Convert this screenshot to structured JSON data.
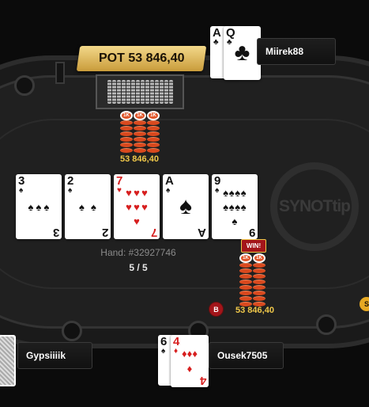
{
  "pot": {
    "label": "POT 53 846,40"
  },
  "pot_chips_amount": "53 846,40",
  "winner_chips_amount": "53 846,40",
  "chip_denomination": "1K",
  "hand": {
    "number": "Hand: #32927746",
    "progress": "5 / 5"
  },
  "win_badge": "WIN!",
  "dealer_button": "B",
  "edge_chip": "S",
  "logo": "SYNOTtip",
  "board": [
    {
      "rank": "3",
      "suit": "♠",
      "color": "black"
    },
    {
      "rank": "2",
      "suit": "♠",
      "color": "black"
    },
    {
      "rank": "7",
      "suit": "♥",
      "color": "red"
    },
    {
      "rank": "A",
      "suit": "♠",
      "color": "black"
    },
    {
      "rank": "9",
      "suit": "♠",
      "color": "black"
    }
  ],
  "players": {
    "top": {
      "name": "Miirek88",
      "cards": [
        {
          "rank": "A",
          "suit": "♣",
          "color": "black"
        },
        {
          "rank": "Q",
          "suit": "♣",
          "color": "black"
        }
      ]
    },
    "left": {
      "name": "Gypsiiiik"
    },
    "bottom": {
      "name": "Ousek7505",
      "cards": [
        {
          "rank": "6",
          "suit": "♠",
          "color": "black"
        },
        {
          "rank": "4",
          "suit": "♦",
          "color": "red"
        }
      ]
    }
  },
  "colors": {
    "pot_gold": "#f0c84a",
    "chip_red": "#d9491e",
    "felt": "#202020",
    "win_red": "#a3151a"
  }
}
